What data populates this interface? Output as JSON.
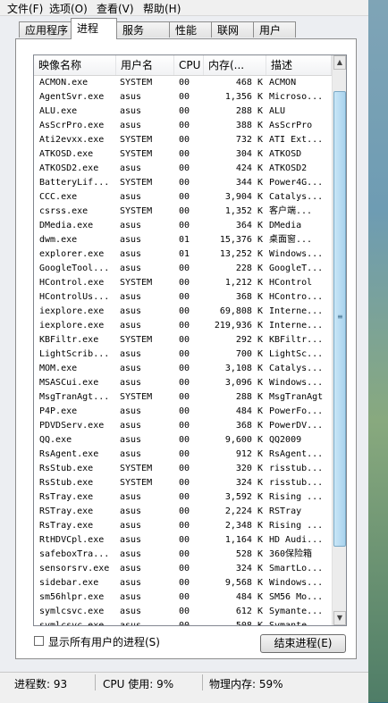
{
  "menu": [
    "文件(F)",
    "选项(O)",
    "查看(V)",
    "帮助(H)"
  ],
  "tabs": [
    "应用程序",
    "进程",
    "服务",
    "性能",
    "联网",
    "用户"
  ],
  "active_tab": 1,
  "columns": {
    "name": "映像名称",
    "user": "用户名",
    "cpu": "CPU",
    "mem": "内存(...",
    "desc": "描述"
  },
  "processes": [
    {
      "name": "ACMON.exe",
      "user": "SYSTEM",
      "cpu": "00",
      "mem": "468 K",
      "desc": "ACMON"
    },
    {
      "name": "AgentSvr.exe",
      "user": "asus",
      "cpu": "00",
      "mem": "1,356 K",
      "desc": "Microso..."
    },
    {
      "name": "ALU.exe",
      "user": "asus",
      "cpu": "00",
      "mem": "288 K",
      "desc": "ALU"
    },
    {
      "name": "AsScrPro.exe",
      "user": "asus",
      "cpu": "00",
      "mem": "388 K",
      "desc": "AsScrPro"
    },
    {
      "name": "Ati2evxx.exe",
      "user": "SYSTEM",
      "cpu": "00",
      "mem": "732 K",
      "desc": "ATI Ext..."
    },
    {
      "name": "ATKOSD.exe",
      "user": "SYSTEM",
      "cpu": "00",
      "mem": "304 K",
      "desc": "ATKOSD"
    },
    {
      "name": "ATKOSD2.exe",
      "user": "asus",
      "cpu": "00",
      "mem": "424 K",
      "desc": "ATKOSD2"
    },
    {
      "name": "BatteryLif...",
      "user": "SYSTEM",
      "cpu": "00",
      "mem": "344 K",
      "desc": "Power4G..."
    },
    {
      "name": "CCC.exe",
      "user": "asus",
      "cpu": "00",
      "mem": "3,904 K",
      "desc": "Catalys..."
    },
    {
      "name": "csrss.exe",
      "user": "SYSTEM",
      "cpu": "00",
      "mem": "1,352 K",
      "desc": "客户端..."
    },
    {
      "name": "DMedia.exe",
      "user": "asus",
      "cpu": "00",
      "mem": "364 K",
      "desc": "DMedia"
    },
    {
      "name": "dwm.exe",
      "user": "asus",
      "cpu": "01",
      "mem": "15,376 K",
      "desc": "桌面窗..."
    },
    {
      "name": "explorer.exe",
      "user": "asus",
      "cpu": "01",
      "mem": "13,252 K",
      "desc": "Windows..."
    },
    {
      "name": "GoogleTool...",
      "user": "asus",
      "cpu": "00",
      "mem": "228 K",
      "desc": "GoogleT..."
    },
    {
      "name": "HControl.exe",
      "user": "SYSTEM",
      "cpu": "00",
      "mem": "1,212 K",
      "desc": "HControl"
    },
    {
      "name": "HControlUs...",
      "user": "asus",
      "cpu": "00",
      "mem": "368 K",
      "desc": "HContro..."
    },
    {
      "name": "iexplore.exe",
      "user": "asus",
      "cpu": "00",
      "mem": "69,808 K",
      "desc": "Interne..."
    },
    {
      "name": "iexplore.exe",
      "user": "asus",
      "cpu": "00",
      "mem": "219,936 K",
      "desc": "Interne..."
    },
    {
      "name": "KBFiltr.exe",
      "user": "SYSTEM",
      "cpu": "00",
      "mem": "292 K",
      "desc": "KBFiltr..."
    },
    {
      "name": "LightScrib...",
      "user": "asus",
      "cpu": "00",
      "mem": "700 K",
      "desc": "LightSc..."
    },
    {
      "name": "MOM.exe",
      "user": "asus",
      "cpu": "00",
      "mem": "3,108 K",
      "desc": "Catalys..."
    },
    {
      "name": "MSASCui.exe",
      "user": "asus",
      "cpu": "00",
      "mem": "3,096 K",
      "desc": "Windows..."
    },
    {
      "name": "MsgTranAgt...",
      "user": "SYSTEM",
      "cpu": "00",
      "mem": "288 K",
      "desc": "MsgTranAgt"
    },
    {
      "name": "P4P.exe",
      "user": "asus",
      "cpu": "00",
      "mem": "484 K",
      "desc": "PowerFo..."
    },
    {
      "name": "PDVDServ.exe",
      "user": "asus",
      "cpu": "00",
      "mem": "368 K",
      "desc": "PowerDV..."
    },
    {
      "name": "QQ.exe",
      "user": "asus",
      "cpu": "00",
      "mem": "9,600 K",
      "desc": "QQ2009"
    },
    {
      "name": "RsAgent.exe",
      "user": "asus",
      "cpu": "00",
      "mem": "912 K",
      "desc": "RsAgent..."
    },
    {
      "name": "RsStub.exe",
      "user": "SYSTEM",
      "cpu": "00",
      "mem": "320 K",
      "desc": "risstub..."
    },
    {
      "name": "RsStub.exe",
      "user": "SYSTEM",
      "cpu": "00",
      "mem": "324 K",
      "desc": "risstub..."
    },
    {
      "name": "RsTray.exe",
      "user": "asus",
      "cpu": "00",
      "mem": "3,592 K",
      "desc": "Rising ..."
    },
    {
      "name": "RSTray.exe",
      "user": "asus",
      "cpu": "00",
      "mem": "2,224 K",
      "desc": "RSTray"
    },
    {
      "name": "RsTray.exe",
      "user": "asus",
      "cpu": "00",
      "mem": "2,348 K",
      "desc": "Rising ..."
    },
    {
      "name": "RtHDVCpl.exe",
      "user": "asus",
      "cpu": "00",
      "mem": "1,164 K",
      "desc": "HD Audi..."
    },
    {
      "name": "safeboxTra...",
      "user": "asus",
      "cpu": "00",
      "mem": "528 K",
      "desc": "360保险箱"
    },
    {
      "name": "sensorsrv.exe",
      "user": "asus",
      "cpu": "00",
      "mem": "324 K",
      "desc": "SmartLo..."
    },
    {
      "name": "sidebar.exe",
      "user": "asus",
      "cpu": "00",
      "mem": "9,568 K",
      "desc": "Windows..."
    },
    {
      "name": "sm56hlpr.exe",
      "user": "asus",
      "cpu": "00",
      "mem": "484 K",
      "desc": "SM56 Mo..."
    },
    {
      "name": "symlcsvc.exe",
      "user": "asus",
      "cpu": "00",
      "mem": "612 K",
      "desc": "Symante..."
    },
    {
      "name": "symlcsvc.exe",
      "user": "asus",
      "cpu": "00",
      "mem": "508 K",
      "desc": "Symante..."
    }
  ],
  "show_all_label": "显示所有用户的进程(S)",
  "end_process_label": "结束进程(E)",
  "status": {
    "processes": "进程数: 93",
    "cpu": "CPU 使用: 9%",
    "memory": "物理内存: 59%"
  },
  "colors": {
    "background": "#eceef2",
    "scroll_thumb": "#a9d3ee"
  }
}
